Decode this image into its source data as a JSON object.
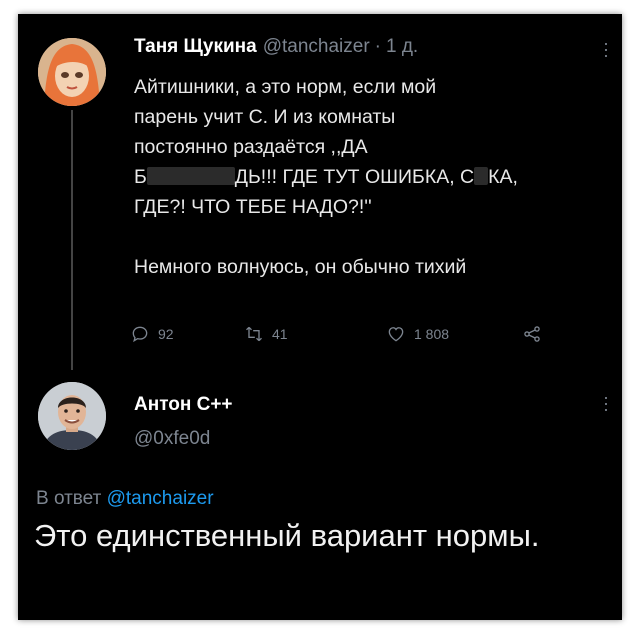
{
  "tweet": {
    "author": "Таня Щукина",
    "handle": "@tanchaizer",
    "separator": "·",
    "time": "1 д.",
    "lines": [
      "Айтишники, а это норм, если мой",
      "парень учит С. И из комнаты",
      "постоянно раздаётся ,,ДА"
    ],
    "line4_a": "Б",
    "line4_b": "ДЬ!!! ГДЕ ТУТ ОШИБКА, С",
    "line4_c": "КА,",
    "line5": "ГДЕ?! ЧТО ТЕБЕ НАДО?!''",
    "last_line": "Немного волнуюсь, он обычно тихий",
    "stats": {
      "replies": "92",
      "retweets": "41",
      "likes": "1 808"
    }
  },
  "reply": {
    "author": "Антон С++",
    "handle": "@0xfe0d",
    "reply_prefix": "В ответ",
    "reply_to": "@tanchaizer",
    "text": "Это единственный вариант нормы."
  },
  "colors": {
    "background": "#000000",
    "muted": "#7d8590",
    "link": "#1d9bf0",
    "text": "#e8e8e8"
  },
  "icons": [
    "reply-icon",
    "retweet-icon",
    "like-icon",
    "share-icon",
    "more-options-icon"
  ]
}
